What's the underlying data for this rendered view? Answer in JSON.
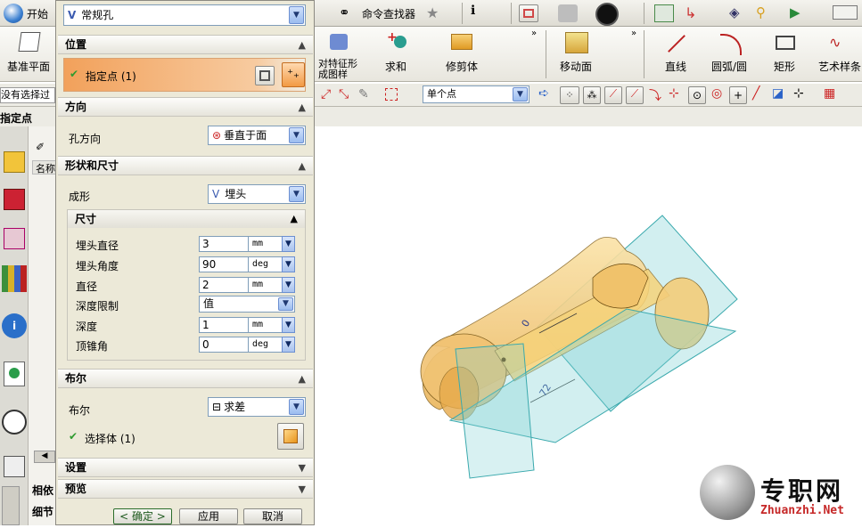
{
  "toolbar": {
    "start_label": "开始",
    "command_finder_label": "命令查找器"
  },
  "ribbon": {
    "datum_plane_label": "基准平面",
    "pattern_label": "对特征形成图样",
    "unite_label": "求和",
    "trim_body_label": "修剪体",
    "move_face_label": "移动面",
    "line_label": "直线",
    "arc_label": "圆弧/圆",
    "rectangle_label": "矩形",
    "studio_spline_label": "艺术样条"
  },
  "selection_bar": {
    "filter_text": "没有选择过",
    "scope_value": "单个点"
  },
  "prompt": {
    "label": "指定点"
  },
  "nav_panel": {
    "name_header": "名称",
    "related_label": "相依",
    "details_label": "细节"
  },
  "dialog": {
    "type_value": "常规孔",
    "position": {
      "header": "位置",
      "specify_point": "指定点 (1)"
    },
    "direction": {
      "header": "方向",
      "hole_direction_label": "孔方向",
      "hole_direction_value": "垂直于面"
    },
    "form": {
      "header": "形状和尺寸",
      "form_label": "成形",
      "form_value": "埋头",
      "dimensions_header": "尺寸",
      "csink_diameter_label": "埋头直径",
      "csink_diameter_value": "3",
      "csink_diameter_unit": "mm",
      "csink_angle_label": "埋头角度",
      "csink_angle_value": "90",
      "csink_angle_unit": "deg",
      "diameter_label": "直径",
      "diameter_value": "2",
      "diameter_unit": "mm",
      "depth_limit_label": "深度限制",
      "depth_limit_value": "值",
      "depth_label": "深度",
      "depth_value": "1",
      "depth_unit": "mm",
      "tip_angle_label": "顶锥角",
      "tip_angle_value": "0",
      "tip_angle_unit": "deg"
    },
    "boolean": {
      "header": "布尔",
      "boolean_label": "布尔",
      "boolean_value": "求差",
      "select_body": "选择体 (1)"
    },
    "settings_header": "设置",
    "preview_header": "预览",
    "ok_label": "< 确定 >",
    "apply_label": "应用",
    "cancel_label": "取消"
  },
  "watermark": {
    "title": "专职网",
    "url": "Zhuanzhi.Net"
  },
  "colors": {
    "accent_orange": "#f0a85c",
    "check_green": "#2f9b2f",
    "part_yellow": "#f6d37a",
    "plane_cyan": "#45b9bd"
  }
}
